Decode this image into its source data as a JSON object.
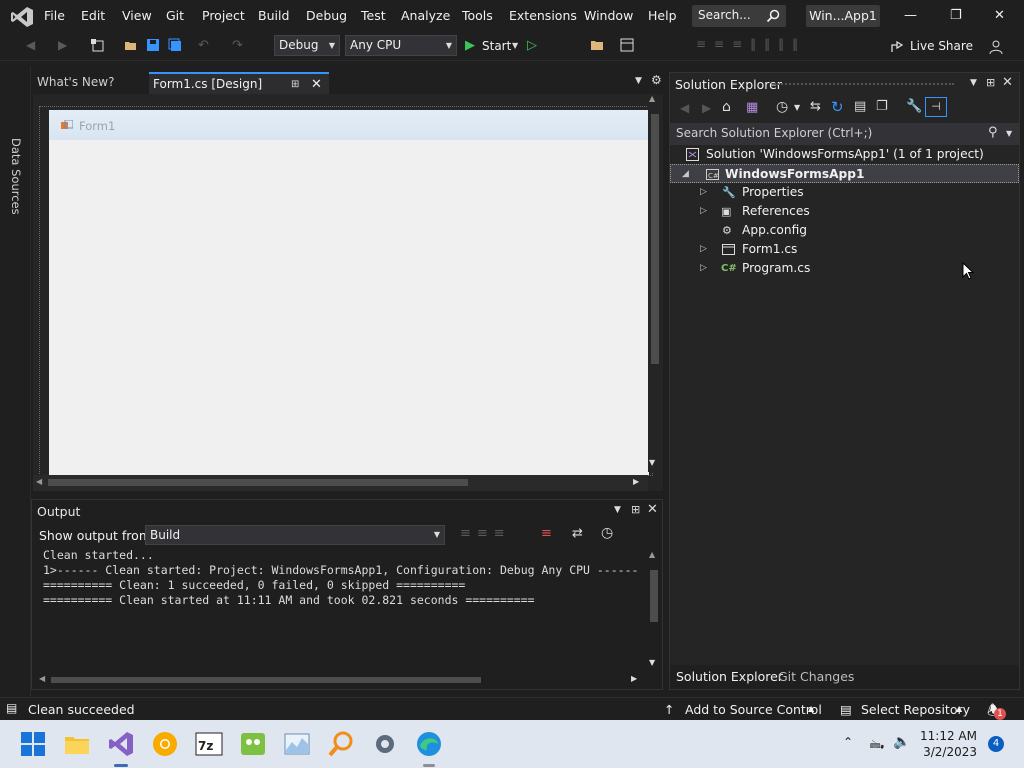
{
  "menu": [
    "File",
    "Edit",
    "View",
    "Git",
    "Project",
    "Build",
    "Debug",
    "Test",
    "Analyze",
    "Tools",
    "Extensions",
    "Window",
    "Help"
  ],
  "search": {
    "label": "Search..."
  },
  "window_title": "Win...App1",
  "toolbar": {
    "config": "Debug",
    "platform": "Any CPU",
    "start_label": "Start",
    "live_share_label": "Live Share"
  },
  "rail": {
    "data_sources": "Data Sources"
  },
  "doc_tabs": {
    "whats_new": "What's New?",
    "form1_design": "Form1.cs [Design]"
  },
  "designer": {
    "form_title": "Form1"
  },
  "output": {
    "title": "Output",
    "show_from_label": "Show output from:",
    "source": "Build",
    "lines": [
      "Clean started...",
      "1>------ Clean started: Project: WindowsFormsApp1, Configuration: Debug Any CPU ------",
      "========== Clean: 1 succeeded, 0 failed, 0 skipped ==========",
      "========== Clean started at 11:11 AM and took 02.821 seconds =========="
    ]
  },
  "solution_explorer": {
    "title": "Solution Explorer",
    "search_placeholder": "Search Solution Explorer (Ctrl+;)",
    "solution": "Solution 'WindowsFormsApp1' (1 of 1 project)",
    "project": "WindowsFormsApp1",
    "items": [
      {
        "label": "Properties",
        "icon": "wrench-icon",
        "expandable": true
      },
      {
        "label": "References",
        "icon": "references-icon",
        "expandable": true
      },
      {
        "label": "App.config",
        "icon": "config-file-icon",
        "expandable": false
      },
      {
        "label": "Form1.cs",
        "icon": "form-icon",
        "expandable": true
      },
      {
        "label": "Program.cs",
        "icon": "csharp-file-icon",
        "expandable": true
      }
    ],
    "bottom_tabs": [
      "Solution Explorer",
      "Git Changes"
    ]
  },
  "status": {
    "message": "Clean succeeded",
    "add_source_control": "Add to Source Control",
    "select_repository": "Select Repository",
    "notification_count": "1"
  },
  "taskbar": {
    "time": "11:12 AM",
    "date": "3/2/2023",
    "notification_badge": "4"
  },
  "colors": {
    "accent": "#3794ff",
    "vs_purple": "#8661c5",
    "background": "#1f1f1f"
  }
}
